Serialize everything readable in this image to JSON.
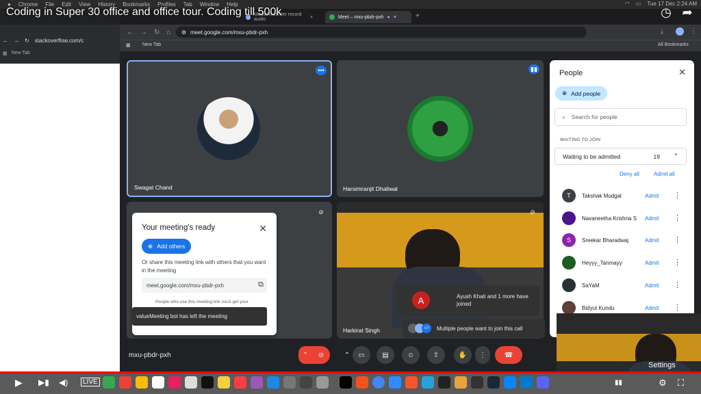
{
  "menubar": {
    "items": [
      "Chrome",
      "File",
      "Edit",
      "View",
      "History",
      "Bookmarks",
      "Profiles",
      "Tab",
      "Window",
      "Help"
    ],
    "clock": "Tue 17 Dec  2:24 AM"
  },
  "video": {
    "title": "Coding in Super 30 office and office tour. Coding till 500k",
    "settings_label": "Settings",
    "progress": 1.0
  },
  "back_window": {
    "url": "stackoverflow.com/c",
    "bookmark": "New Tab"
  },
  "browser": {
    "tabs": [
      {
        "label": "MediaRecorder record audio"
      },
      {
        "label": "Meet – mxu-pbdr-pxh",
        "active": true
      }
    ],
    "url": "meet.google.com/mxu-pbdr-pxh",
    "bookmark_new_tab": "New Tab",
    "all_bookmarks": "All Bookmarks"
  },
  "meet": {
    "tiles": [
      {
        "name": "Swagat Chand"
      },
      {
        "name": "Harsimranjit Dhaliwal"
      },
      {
        "name": "Harkirat Singh"
      }
    ],
    "meeting_code": "mxu-pbdr-pxh",
    "ready_dialog": {
      "title": "Your meeting's ready",
      "add_others": "Add others",
      "description": "Or share this meeting link with others that you want in the meeting",
      "link": "meet.google.com/mxu-pbdr-pxh",
      "note": "People who use this meeting link must get your"
    },
    "bot_toast": "valueMeeting bot has left the meeting",
    "joined_toast": {
      "avatar_letter": "A",
      "text": "Ayush Khati and 1 more have joined"
    },
    "multi_toast": {
      "badge": "+17",
      "text": "Multiple people want to join this call"
    }
  },
  "people": {
    "title": "People",
    "add_people": "Add people",
    "search_placeholder": "Search for people",
    "section": "WAITING TO JOIN",
    "group_label": "Waiting to be admitted",
    "group_count": "19",
    "deny_all": "Deny all",
    "admit_all": "Admit all",
    "admit_label": "Admit",
    "waiting": [
      {
        "name": "Takshak Mudgal",
        "initial": "T",
        "color": "#3c4043"
      },
      {
        "name": "Navaneetha Krishna S",
        "initial": "",
        "color": "#4a148c"
      },
      {
        "name": "Sreekar Bharadwaj",
        "initial": "S",
        "color": "#8e24aa"
      },
      {
        "name": "Heyyy_Tanmayy",
        "initial": "",
        "color": "#1b5e20"
      },
      {
        "name": "SaYaM",
        "initial": "",
        "color": "#263238"
      },
      {
        "name": "Bidyut Kundu",
        "initial": "",
        "color": "#5d4037"
      }
    ]
  },
  "colors": {
    "accent": "#1a73e8",
    "hangup": "#ea4335",
    "meet_bg": "#202124",
    "tile": "#3c4043"
  }
}
